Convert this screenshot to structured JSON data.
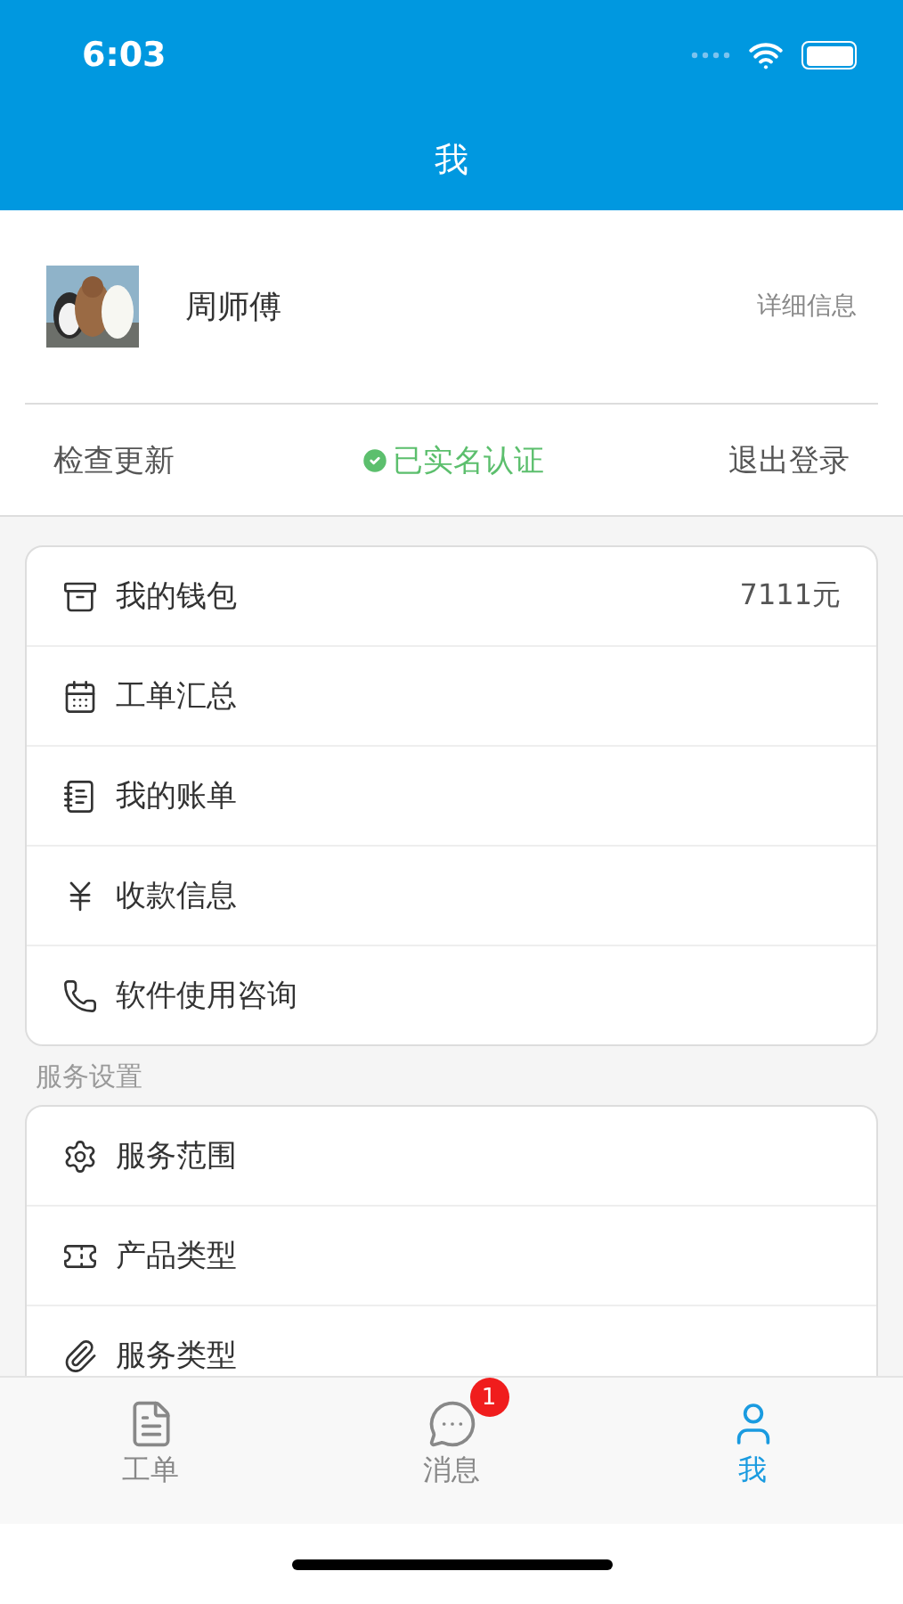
{
  "status_bar": {
    "time": "6:03"
  },
  "header": {
    "title": "我"
  },
  "profile": {
    "name": "周师傅",
    "detail_link": "详细信息"
  },
  "actions": [
    {
      "label": "检查更新",
      "kind": "link"
    },
    {
      "label": "已实名认证",
      "kind": "verified"
    },
    {
      "label": "退出登录",
      "kind": "link"
    }
  ],
  "menu": [
    {
      "label": "我的钱包",
      "value": "7111元"
    },
    {
      "label": "工单汇总"
    },
    {
      "label": "我的账单"
    },
    {
      "label": "收款信息"
    },
    {
      "label": "软件使用咨询"
    }
  ],
  "service_settings": {
    "title": "服务设置",
    "items": [
      {
        "label": "服务范围"
      },
      {
        "label": "产品类型"
      },
      {
        "label": "服务类型"
      }
    ]
  },
  "tab_bar": [
    {
      "label": "工单",
      "selected": false
    },
    {
      "label": "消息",
      "selected": false,
      "badge": "1"
    },
    {
      "label": "我",
      "selected": true
    }
  ]
}
